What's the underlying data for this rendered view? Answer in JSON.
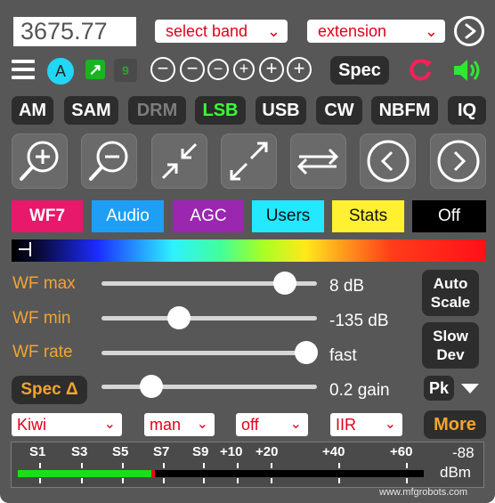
{
  "frequency": "3675.77",
  "band_select": "select band",
  "extension_select": "extension",
  "view": {
    "circle_label": "A",
    "step_label": "9",
    "spec_label": "Spec"
  },
  "modes": [
    "AM",
    "SAM",
    "DRM",
    "LSB",
    "USB",
    "CW",
    "NBFM",
    "IQ"
  ],
  "active_mode": "LSB",
  "disabled_mode": "DRM",
  "tabs": {
    "wf": "WF7",
    "audio": "Audio",
    "agc": "AGC",
    "users": "Users",
    "stats": "Stats",
    "off": "Off"
  },
  "tab_colors": {
    "wf": "#e8186b",
    "audio": "#1e9ff5",
    "agc": "#9b27b0",
    "users": "#23e8ff",
    "stats": "#fff032",
    "off": "#000000"
  },
  "sliders": {
    "wf_max": {
      "label": "WF max",
      "value": "8 dB",
      "level": 0.85
    },
    "wf_min": {
      "label": "WF min",
      "value": "-135 dB",
      "level": 0.36
    },
    "wf_rate": {
      "label": "WF rate",
      "value": "fast",
      "level": 0.95
    },
    "spec_delta": {
      "label": "Spec Δ",
      "value": "0.2 gain",
      "level": 0.23
    }
  },
  "side_buttons": {
    "auto_scale": [
      "Auto",
      "Scale"
    ],
    "slow_dev": [
      "Slow",
      "Dev"
    ],
    "pk": "Pk"
  },
  "bottom_selects": {
    "colormap": "Kiwi",
    "mode": "man",
    "state": "off",
    "filter": "IIR"
  },
  "more_label": "More",
  "smeter": {
    "labels": [
      "S1",
      "S3",
      "S5",
      "S7",
      "S9",
      "+10",
      "+20",
      "+40",
      "+60"
    ],
    "reading": "-88",
    "unit": "dBm",
    "level": 0.33
  },
  "watermark": "www.mfgrobots.com"
}
